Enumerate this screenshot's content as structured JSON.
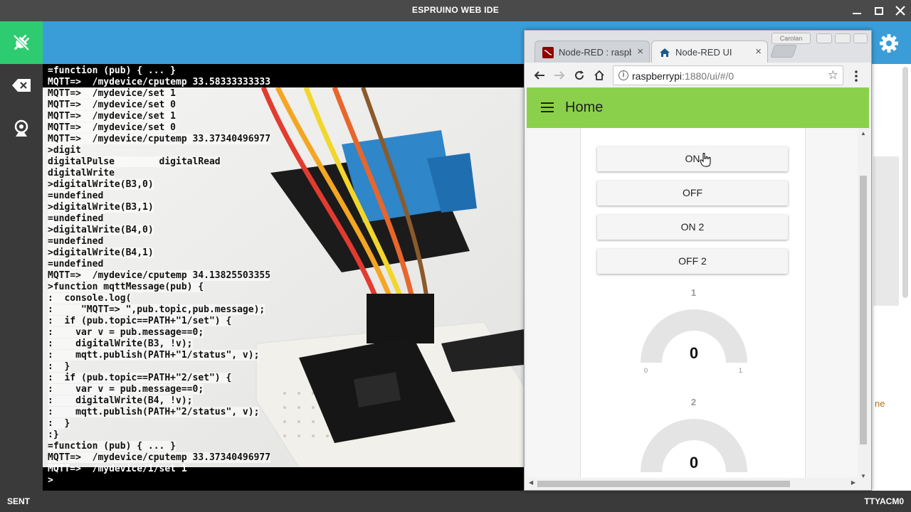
{
  "window": {
    "title": "ESPRUINO WEB IDE"
  },
  "terminal": {
    "lines": [
      "=function (pub) { ... }",
      "MQTT=>  /mydevice/cputemp 33.58333333333",
      "MQTT=>  /mydevice/set 1",
      "MQTT=>  /mydevice/set 0",
      "MQTT=>  /mydevice/set 1",
      "MQTT=>  /mydevice/set 0",
      "MQTT=>  /mydevice/cputemp 33.37340496977",
      ">digit",
      "digitalPulse        digitalRead",
      "digitalWrite",
      ">digitalWrite(B3,0)",
      "=undefined",
      ">digitalWrite(B3,1)",
      "=undefined",
      ">digitalWrite(B4,0)",
      "=undefined",
      ">digitalWrite(B4,1)",
      "=undefined",
      "MQTT=>  /mydevice/cputemp 34.13825503355",
      ">function mqttMessage(pub) {",
      ":  console.log(",
      ":     \"MQTT=> \",pub.topic,pub.message);",
      ":  if (pub.topic==PATH+\"1/set\") {",
      ":    var v = pub.message==0;",
      ":    digitalWrite(B3, !v);",
      ":    mqtt.publish(PATH+\"1/status\", v);",
      ":  }",
      ":  if (pub.topic==PATH+\"2/set\") {",
      ":    var v = pub.message==0;",
      ":    digitalWrite(B4, !v);",
      ":    mqtt.publish(PATH+\"2/status\", v);",
      ":  }",
      ":}",
      "=function (pub) { ... }",
      "MQTT=>  /mydevice/cputemp 33.37340496977",
      "MQTT=>  /mydevice/1/set 1",
      ">"
    ]
  },
  "status": {
    "left": "SENT",
    "right": "TTYACM0"
  },
  "ide_right_fragment": "ne",
  "browser": {
    "tabs": [
      {
        "label": "Node-RED : raspb",
        "close": "×"
      },
      {
        "label": "Node-RED UI",
        "close": "×"
      }
    ],
    "profile": "Carolan",
    "url_host": "raspberrypi",
    "url_rest": ":1880/ui/#/0",
    "info_icon": "i",
    "star": "☆"
  },
  "dashboard": {
    "page_title": "Home",
    "buttons": [
      "ON",
      "OFF",
      "ON 2",
      "OFF 2"
    ],
    "gauges": [
      {
        "title": "1",
        "value": 0,
        "min": 0,
        "max": 1
      },
      {
        "title": "2",
        "value": 0,
        "min": 0,
        "max": 1
      }
    ]
  }
}
